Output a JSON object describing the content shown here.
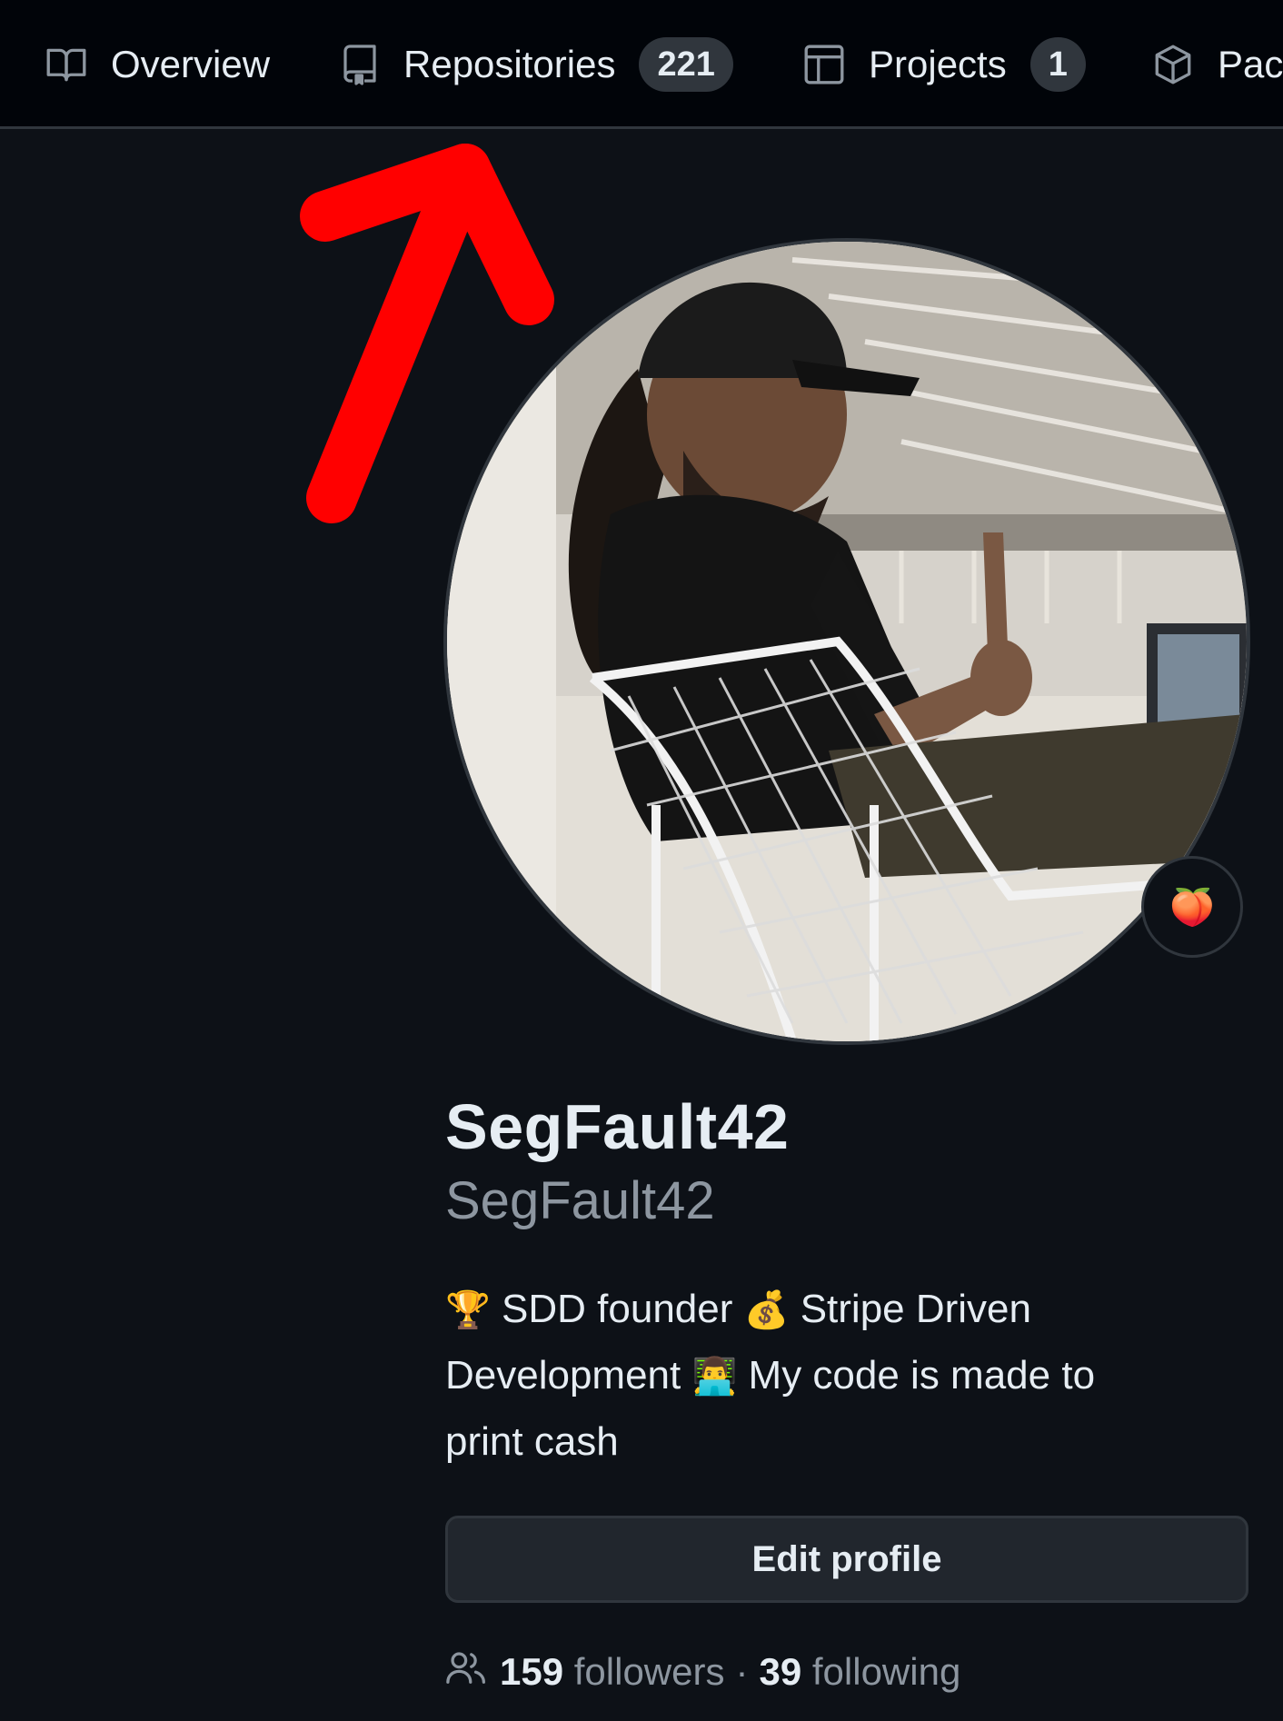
{
  "nav": {
    "tabs": [
      {
        "label": "Overview",
        "icon": "book-icon"
      },
      {
        "label": "Repositories",
        "icon": "repo-icon",
        "count": "221"
      },
      {
        "label": "Projects",
        "icon": "table-icon",
        "count": "1"
      },
      {
        "label": "Pac",
        "icon": "package-icon"
      }
    ]
  },
  "profile": {
    "avatar": "profile-photo",
    "status_emoji": "🍑",
    "name": "SegFault42",
    "login": "SegFault42",
    "bio": {
      "line1": {
        "emoji_trophy": "🏆",
        "text_a": "SDD founder",
        "emoji_money": "💰",
        "text_b": "Stripe Driven"
      },
      "line2": {
        "text_a": "Development",
        "emoji_technologist": "👨‍💻",
        "text_b": "My code is made to"
      },
      "line3": "print cash"
    },
    "edit_button": "Edit profile",
    "followers_count": "159",
    "followers_label": "followers",
    "separator": "·",
    "following_count": "39",
    "following_label": "following"
  },
  "colors": {
    "background": "#0d1117",
    "nav_background": "#010409",
    "border": "#30363d",
    "text": "#e6edf3",
    "muted": "#8d96a0",
    "annotation_arrow": "#ff0000"
  }
}
